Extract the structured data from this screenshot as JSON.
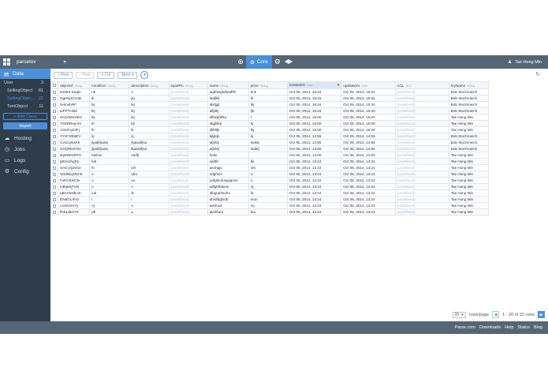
{
  "topbar": {
    "app_name": "parselov",
    "tab_core": "Core",
    "user_name": "Tae Hong Min"
  },
  "sidebar": {
    "data_label": "Data",
    "classes": [
      {
        "name": "User",
        "count": "3"
      },
      {
        "name": "SellingObject",
        "count": "81"
      },
      {
        "name": "SellingObjec...",
        "count": "22"
      },
      {
        "name": "TestObject",
        "count": "11"
      }
    ],
    "add_class": "+ Add Class",
    "import": "Import",
    "nav": [
      {
        "label": "Hosting",
        "icon": "cloud-icon"
      },
      {
        "label": "Jobs",
        "icon": "clock-icon"
      },
      {
        "label": "Logs",
        "icon": "document-icon"
      },
      {
        "label": "Config",
        "icon": "gear-icon"
      }
    ]
  },
  "toolbar": {
    "add_row": "+ Row",
    "remove_row": "- Row",
    "add_col": "+ Col",
    "more": "More ▾"
  },
  "table": {
    "columns": [
      {
        "name": "objectId",
        "type": "String"
      },
      {
        "name": "condition",
        "type": "String"
      },
      {
        "name": "description",
        "type": "String"
      },
      {
        "name": "inputPic",
        "type": "String"
      },
      {
        "name": "name",
        "type": "String"
      },
      {
        "name": "price",
        "type": "String"
      },
      {
        "name": "createdAt",
        "type": "Date"
      },
      {
        "name": "updatedAt",
        "type": "Date"
      },
      {
        "name": "ACL",
        "type": "ACL"
      },
      {
        "name": "myName",
        "type": "String"
      }
    ],
    "rows": [
      [
        "5m8Hi-KaqD",
        "nk",
        "n",
        "(undefined)",
        "aqdfasjdafasdfkl",
        "knk",
        "Oct 05, 2014, 15:34",
        "Oct 05, 2014, 15:34",
        "(undefined)",
        "Bob Stochmeich"
      ],
      [
        "GgHkjJCVnB",
        "lk",
        "jkj",
        "(undefined)",
        "ladjfklj",
        "lk",
        "Oct 05, 2014, 15:34",
        "Oct 05, 2014, 15:34",
        "(undefined)",
        "Bob Stochmeich"
      ],
      [
        "5HmahRF",
        "lkj",
        "lkj",
        "(undefined)",
        "ldsfjgjl",
        "lkj",
        "Oct 05, 2014, 15:34",
        "Oct 05, 2014, 15:34",
        "(undefined)",
        "Bob Stochmeich"
      ],
      [
        "aiPPTHi6Z",
        "lkj",
        "lkj",
        "(undefined)",
        "alfjdkj",
        "ljk",
        "Oct 05, 2014, 15:33",
        "Oct 05, 2014, 15:33",
        "(undefined)",
        "Bob Stochmeich"
      ],
      [
        "HN10MSHEG",
        "lkj",
        "lkj",
        "(undefined)",
        "ldflasjfdfka",
        "l",
        "Oct 05, 2014, 15:00",
        "Oct 05, 2014, 15:00",
        "(undefined)",
        "Tae Hong Min"
      ],
      [
        "7G8DReyrvX",
        "kl",
        "kjl",
        "(undefined)",
        "sfgjkfkjl",
        "kj",
        "Oct 05, 2014, 15:00",
        "Oct 05, 2014, 15:00",
        "(undefined)",
        "Tae Hong Min"
      ],
      [
        "1G5rFyE3Fj",
        "lk",
        "lk",
        "(undefined)",
        "ldfklljk",
        "lkj",
        "Oct 05, 2014, 15:00",
        "Oct 05, 2014, 15:00",
        "(undefined)",
        "Tae Hong Min"
      ],
      [
        "YYvF30b8FJ",
        "kj",
        "kj",
        "(undefined)",
        "kjkjkjk",
        "kj",
        "Oct 05, 2014, 14:55",
        "Oct 05, 2014, 14:55",
        "(undefined)",
        "Bob Stochmeich"
      ],
      [
        "CxsCqN4Kh",
        "jljaldfjsiakj",
        "lkjasidfjsa",
        "(undefined)",
        "afjsfdj",
        "lsafdj",
        "Oct 05, 2014, 14:55",
        "Oct 05, 2014, 14:55",
        "(undefined)",
        "Bob Stochmeich"
      ],
      [
        "S2ZjREvFDn",
        "jljaldfjsiakj",
        "lkjasidfjsa",
        "(undefined)",
        "afjsfdj",
        "lsafdj",
        "Oct 05, 2014, 14:55",
        "Oct 05, 2014, 14:55",
        "(undefined)",
        "Bob Stochmeich"
      ],
      [
        "Ikp8N8HhPO",
        "bellow",
        "sddfj",
        "(undefined)",
        "hello",
        "",
        "Oct 05, 2014, 14:00",
        "Oct 05, 2014, 14:00",
        "(undefined)",
        "Tae Hong Min"
      ],
      [
        "g6mvzhgFp",
        "lub",
        "",
        "(undefined)",
        "asdfb",
        "lki",
        "Oct 05, 2014, 13:24",
        "Oct 05, 2014, 13:24",
        "(undefined)",
        "Tae Hong Min"
      ],
      [
        "SmCyQZe03",
        "ih",
        "ioh",
        "(undefined)",
        "asohgjo",
        "oih",
        "Oct 05, 2014, 13:24",
        "Oct 05, 2014, 13:24",
        "(undefined)",
        "Tae Hong Min"
      ],
      [
        "SDd6bqOKn6",
        "o",
        "obo",
        "(undefined)",
        "odghion",
        "o",
        "Oct 05, 2014, 13:24",
        "Oct 05, 2014, 13:24",
        "(undefined)",
        "Tae Hong Min"
      ],
      [
        "FxRU3XK3e",
        "o",
        "no",
        "(undefined)",
        "udfghiohasgojnon",
        "o",
        "Oct 05, 2014, 13:24",
        "Oct 05, 2014, 13:24",
        "(undefined)",
        "Tae Hong Min"
      ],
      [
        "e3bptejTVN",
        "n",
        "n",
        "(undefined)",
        "sdfghlfdsmn",
        "nj",
        "Oct 05, 2014, 13:24",
        "Oct 05, 2014, 13:24",
        "(undefined)",
        "Tae Hong Min"
      ],
      [
        "qBAHS9bn4t",
        "iub",
        "ib",
        "(undefined)",
        "idhguahsohu",
        "ib",
        "Oct 05, 2014, 13:24",
        "Oct 05, 2014, 13:24",
        "(undefined)",
        "Tae Hong Min"
      ],
      [
        "DN6GLIFxIi",
        "i",
        "i",
        "(undefined)",
        "ahiofbghiob",
        "niun",
        "Oct 05, 2014, 13:24",
        "Oct 05, 2014, 13:24",
        "(undefined)",
        "Tae Hong Min"
      ],
      [
        "Lrv9VSH7y",
        "nj",
        "n",
        "(undefined)",
        "ashfouh",
        "inj",
        "Oct 05, 2014, 13:23",
        "Oct 05, 2014, 13:23",
        "(undefined)",
        "Tae Hong Min"
      ],
      [
        "fGb1db4YK",
        "ph",
        "u",
        "(undefined)",
        "akshfum",
        "biu",
        "Oct 05, 2014, 13:23",
        "Oct 05, 2014, 13:23",
        "(undefined)",
        "Tae Hong Min"
      ]
    ]
  },
  "pager": {
    "page_size": "20",
    "rows_per_page": "rows/page",
    "range": "1 - 20 of 22 rows"
  },
  "footer": {
    "links": [
      "Parse.com",
      "Downloads",
      "Help",
      "Status",
      "Blog"
    ]
  }
}
